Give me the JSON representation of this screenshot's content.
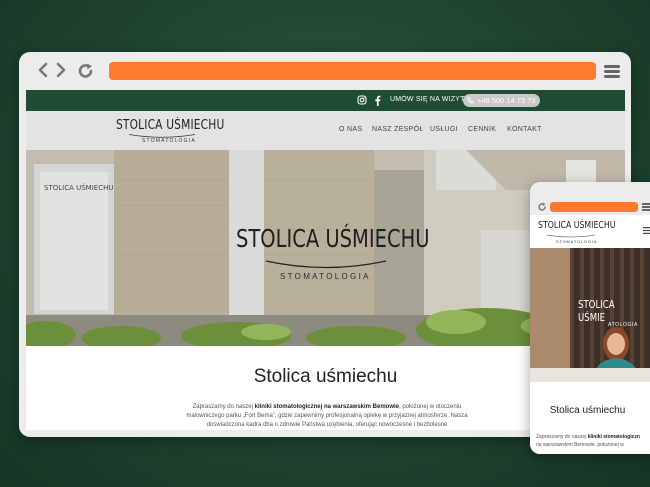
{
  "desktop": {
    "topbar": {
      "visit_label": "UMÓW SIĘ NA WIZYTĘ:",
      "phone": "+48 500 14 73 73"
    },
    "header": {
      "logo_name": "STOLICA UŚMIECHU",
      "logo_sub": "STOMATOLOGIA",
      "menu": [
        "O NAS",
        "NASZ ZESPÓŁ",
        "USŁUGI",
        "CENNIK",
        "KONTAKT"
      ]
    },
    "hero": {
      "logo_name": "STOLICA UŚMIECHU",
      "logo_sub": "STOMATOLOGIA"
    },
    "content": {
      "title": "Stolica uśmiechu",
      "text_1": "Zapraszamy do naszej ",
      "text_bold": "kliniki stomatologicznej na warszawskim Bemowie",
      "text_2": ", położonej w otoczeniu malowniczego parku „Fort Bema”, gdzie zapewnimy profesjonalną opiekę w przyjaznej atmosferze. Nasza doświadczona kadra dba o zdrowie Państwa uzębienia, oferując nowoczesne i bezbolesne"
    }
  },
  "mobile": {
    "header": {
      "logo_name": "STOLICA UŚMIECHU",
      "logo_sub": "STOMATOLOGIA"
    },
    "hero": {
      "logo_name": "STOLICA UŚMIE",
      "logo_sub": "ATOLOGIA"
    },
    "content": {
      "title": "Stolica uśmiechu",
      "text_1": "Zapraszamy do naszej ",
      "text_bold": "kliniki stomatologiczn",
      "text_2": "na warszawskim Bemowie, położonej w"
    }
  },
  "colors": {
    "accent": "#ff7a2e",
    "brand_green": "#1f4d33",
    "background_green": "#1f4430"
  },
  "icons": [
    "back-icon",
    "forward-icon",
    "refresh-icon",
    "hamburger-menu-icon",
    "instagram-icon",
    "facebook-icon",
    "phone-icon"
  ]
}
